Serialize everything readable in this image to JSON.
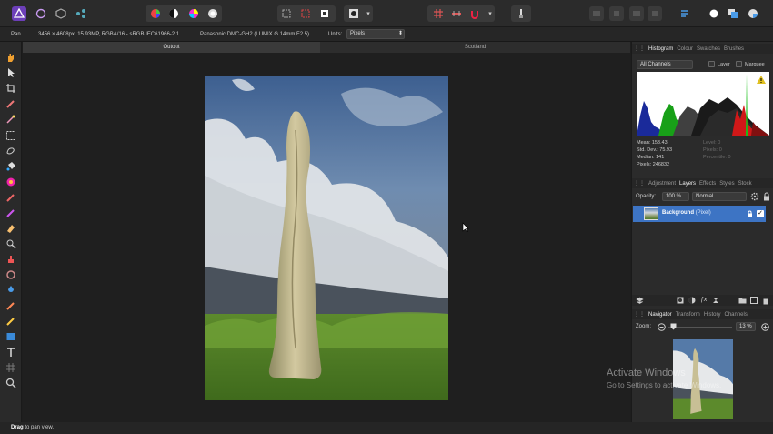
{
  "context_bar": {
    "tool": "Pan",
    "doc_info": "3456 × 4608px, 15.93MP, RGBA/16 - sRGB IEC61966-2.1",
    "camera": "Panasonic DMC-GH2 (LUMIX G 14mm F2.5)",
    "units_label": "Units:",
    "units_value": "Pixels"
  },
  "doc_tabs": [
    "Outout",
    "Scotland"
  ],
  "histogram_panel": {
    "tabs": [
      "Histogram",
      "Colour",
      "Swatches",
      "Brushes"
    ],
    "channel": "All Channels",
    "layer_label": "Layer",
    "marquee_label": "Marquee",
    "stats_left": [
      "Mean: 153.43",
      "Std. Dev.: 75.93",
      "Median: 141",
      "Pixels: 246832"
    ],
    "stats_right": [
      "Level: 0",
      "Pixels: 0",
      "Percentile: 0"
    ],
    "warning_icon": "warning-icon"
  },
  "layers_panel": {
    "tabs": [
      "Adjustment",
      "Layers",
      "Effects",
      "Styles",
      "Stock"
    ],
    "opacity_label": "Opacity:",
    "opacity_value": "100 %",
    "blend_mode": "Normal",
    "layer_name": "Background",
    "layer_type": "(Pixel)"
  },
  "navigator_panel": {
    "tabs": [
      "Navigator",
      "Transform",
      "History",
      "Channels"
    ],
    "zoom_label": "Zoom:",
    "zoom_value": "13 %"
  },
  "status": {
    "bold": "Drag",
    "text": " to pan view."
  },
  "watermark": {
    "line1": "Activate Windows",
    "line2": "Go to Settings to activate Windows."
  },
  "colors": {
    "selection": "#3d74c4",
    "warning": "#e0c020",
    "accent_persona": "#8a5bd0"
  }
}
